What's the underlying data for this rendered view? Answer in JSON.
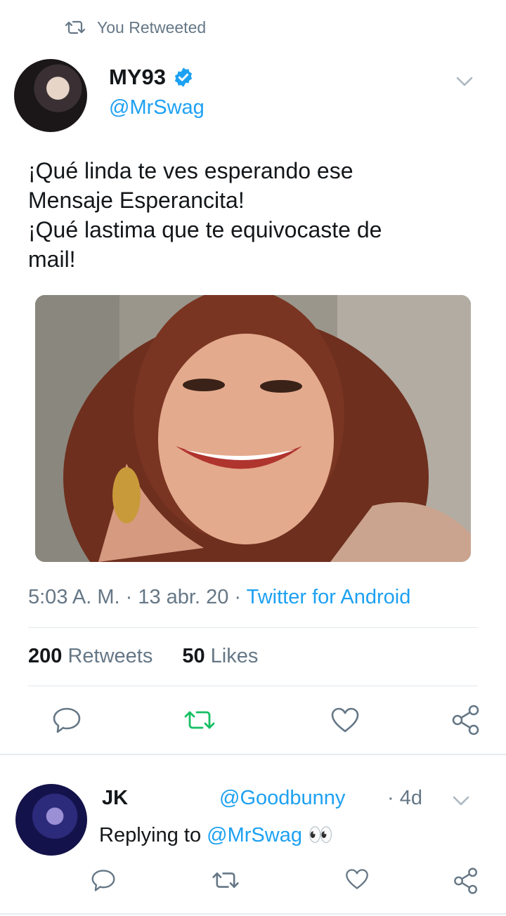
{
  "retweet_context": {
    "icon": "retweet-icon",
    "label": "You Retweeted"
  },
  "tweet": {
    "author_name": "MY93",
    "verified": true,
    "handle": "@MrSwag",
    "text": "¡Qué linda te ves esperando ese\nMensaje Esperancita!\n¡Qué lastima que te equivocaste de\nmail!",
    "time": "5:03 A. M.",
    "date": "13 abr. 20",
    "source": "Twitter for Android",
    "retweet_count": "200",
    "retweet_label": "Retweets",
    "like_count": "50",
    "like_label": "Likes"
  },
  "actions": [
    "reply-icon",
    "retweet-icon",
    "like-icon",
    "share-icon"
  ],
  "colors": {
    "accent": "#1da1f2",
    "retweet_active": "#17bf63",
    "secondary_text": "#657786"
  },
  "reply": {
    "author_name": "JK",
    "handle": "@Goodbunny",
    "time": "4d",
    "replying_prefix": "Replying to",
    "replying_handle": "@MrSwag",
    "emoji": "👀"
  }
}
